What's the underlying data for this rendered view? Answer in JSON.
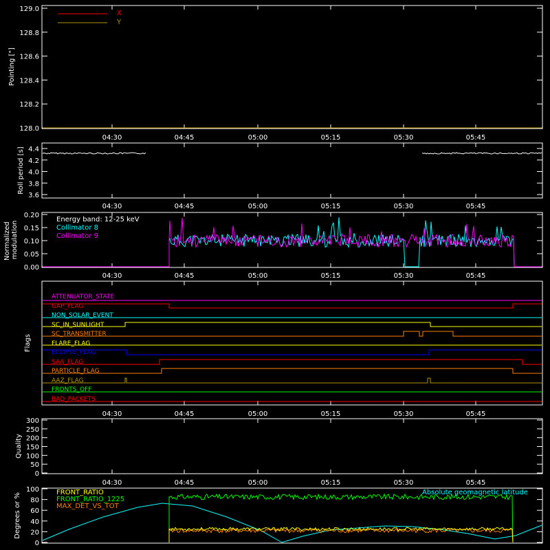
{
  "chart_data": [
    {
      "type": "line",
      "ylabel": "Pointing [\"]",
      "ylim": [
        128.0,
        129.0
      ],
      "yticks": [
        "129.0",
        "128.8",
        "128.6",
        "128.4",
        "128.2",
        "128.0"
      ],
      "xticks": [
        "04:30",
        "04:45",
        "05:00",
        "05:15",
        "05:30",
        "05:45"
      ],
      "series": [
        {
          "name": "X",
          "color": "#ff0000",
          "values": [
            128.0,
            128.0
          ]
        },
        {
          "name": "Y",
          "color": "#b59400",
          "values": [
            128.0,
            128.0
          ]
        }
      ]
    },
    {
      "type": "line",
      "ylabel": "Roll period [s]",
      "ylim": [
        3.5,
        4.5
      ],
      "yticks": [
        "4.4",
        "4.2",
        "4.0",
        "3.8",
        "3.6"
      ],
      "xticks": [
        "04:30",
        "04:45",
        "05:00",
        "05:15",
        "05:30",
        "05:45"
      ],
      "series": [
        {
          "name": "",
          "color": "#ffffff",
          "value": 4.3
        }
      ]
    },
    {
      "type": "line",
      "ylabel": "Normalized modulation",
      "ylim": [
        0.0,
        0.2
      ],
      "yticks": [
        "0.20",
        "0.15",
        "0.10",
        "0.05",
        "0.00"
      ],
      "xticks": [
        "04:30",
        "04:45",
        "05:00",
        "05:15",
        "05:30",
        "05:45"
      ],
      "annotations": [
        "Energy band: 12-25 keV"
      ],
      "series": [
        {
          "name": "Collimator 8",
          "color": "#00ffff",
          "baseline": 0.1
        },
        {
          "name": "Collimator 9",
          "color": "#ff00ff",
          "baseline": 0.1
        }
      ]
    },
    {
      "type": "line",
      "ylabel": "Flags",
      "xticks": [
        "04:30",
        "04:45",
        "05:00",
        "05:15",
        "05:30",
        "05:45"
      ],
      "series": [
        {
          "name": "ATTENUATOR_STATE",
          "color": "#ff00ff"
        },
        {
          "name": "SAA_FLAG_top",
          "label": "GAP_FLAG",
          "color": "#ff0000"
        },
        {
          "name": "NON_SOLAR_EVENT",
          "color": "#00ffff"
        },
        {
          "name": "SC_IN_SUNLIGHT",
          "color": "#ffff00"
        },
        {
          "name": "SC_TRANSMITTER",
          "color": "#ff8000"
        },
        {
          "name": "FLARE_FLAG",
          "color": "#ffff00"
        },
        {
          "name": "ECLIPSE_FLAG",
          "color": "#0000ff"
        },
        {
          "name": "SAA_FLAG",
          "color": "#ff0000"
        },
        {
          "name": "PARTICLE_FLAG",
          "color": "#ff8000"
        },
        {
          "name": "AAZ_FLAG",
          "color": "#b59400"
        },
        {
          "name": "FRONTS_OFF",
          "color": "#00ff00"
        },
        {
          "name": "BAD_PACKETS",
          "color": "#ff0000"
        }
      ]
    },
    {
      "type": "line",
      "ylabel": "Quality",
      "ylim": [
        0,
        300
      ],
      "yticks": [
        "300",
        "250",
        "200",
        "150",
        "100",
        "50",
        "0"
      ],
      "xticks": [
        "04:30",
        "04:45",
        "05:00",
        "05:15",
        "05:30",
        "05:45"
      ],
      "series": []
    },
    {
      "type": "line",
      "ylabel": "Degrees or %",
      "ylim": [
        0,
        100
      ],
      "yticks": [
        "100",
        "80",
        "60",
        "40",
        "20",
        "0"
      ],
      "series": [
        {
          "name": "FRONT_RATIO",
          "color": "#ffff00",
          "baseline": 25
        },
        {
          "name": "FRONT_RATIO_1225",
          "color": "#00ff00",
          "baseline": 85
        },
        {
          "name": "MAX_DET_VS_TOT",
          "color": "#ff8000",
          "baseline": 22
        },
        {
          "name": "Absolute geomagnetic latitude",
          "color": "#00ffff"
        }
      ]
    }
  ]
}
